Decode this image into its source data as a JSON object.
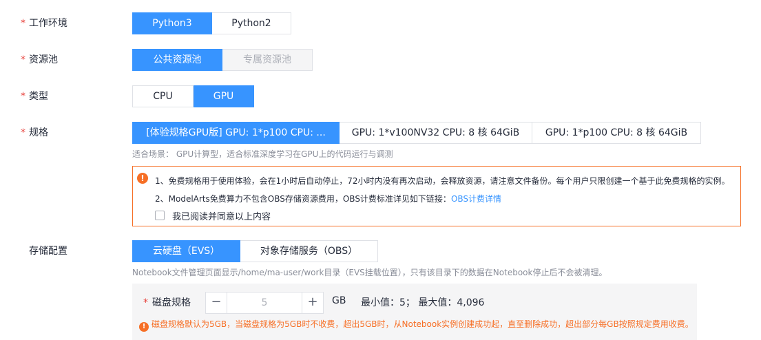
{
  "env": {
    "label": "工作环境",
    "options": [
      "Python3",
      "Python2"
    ],
    "selected": "Python3"
  },
  "pool": {
    "label": "资源池",
    "options": [
      "公共资源池",
      "专属资源池"
    ],
    "selected": "公共资源池"
  },
  "type": {
    "label": "类型",
    "options": [
      "CPU",
      "GPU"
    ],
    "selected": "GPU"
  },
  "spec": {
    "label": "规格",
    "options": [
      "[体验规格GPU版] GPU: 1*p100 CPU: ...",
      "GPU: 1*v100NV32 CPU: 8 核 64GiB",
      "GPU: 1*p100 CPU: 8 核 64GiB"
    ],
    "selected": "[体验规格GPU版] GPU: 1*p100 CPU: ...",
    "hint": "适合场景： GPU计算型，适合标准深度学习在GPU上的代码运行与调测"
  },
  "notice": {
    "line1": "1、免费规格用于使用体验，会在1小时后自动停止，72小时内没有再次启动，会释放资源，请注意文件备份。每个用户只限创建一个基于此免费规格的实例。",
    "line2_text": "2、ModelArts免费算力不包含OBS存储资源费用，OBS计费标准详见如下链接：",
    "line2_link": "OBS计费详情",
    "agree": "我已阅读并同意以上内容",
    "agreed": false
  },
  "storage": {
    "label": "存储配置",
    "options": [
      "云硬盘（EVS）",
      "对象存储服务（OBS）"
    ],
    "selected": "云硬盘（EVS）",
    "hint": "Notebook文件管理页面显示/home/ma-user/work目录（EVS挂载位置），只有该目录下的数据在Notebook停止后不会被清理。"
  },
  "disk": {
    "label": "磁盘规格",
    "minus": "−",
    "plus": "+",
    "value": "5",
    "unit": "GB",
    "range": "最小值：5；  最大值：4,096",
    "warning": "磁盘规格默认为5GB，当磁盘规格为5GB时不收费，超出5GB时，从Notebook实例创建成功起，直至删除成功，超出部分每GB按照规定费用收费。"
  },
  "required_mark": "*",
  "warn_glyph": "!",
  "colors": {
    "accent": "#3794ff",
    "warning": "#f66f26",
    "required": "#e7413b"
  }
}
